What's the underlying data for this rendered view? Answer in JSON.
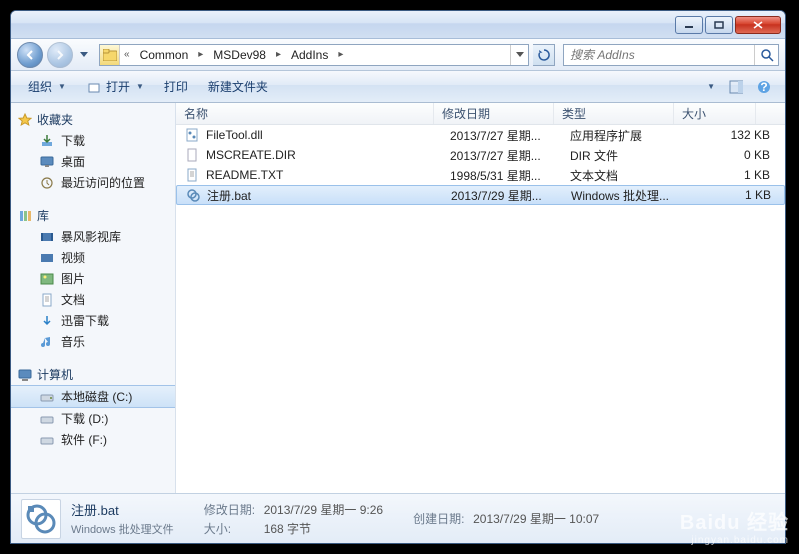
{
  "titlebar": {},
  "nav": {
    "crumbs": [
      "Common",
      "MSDev98",
      "AddIns"
    ],
    "search_placeholder": "搜索 AddIns"
  },
  "toolbar": {
    "organize": "组织",
    "open": "打开",
    "print": "打印",
    "newfolder": "新建文件夹"
  },
  "sidebar": {
    "fav": {
      "label": "收藏夹",
      "items": [
        "下载",
        "桌面",
        "最近访问的位置"
      ]
    },
    "lib": {
      "label": "库",
      "items": [
        "暴风影视库",
        "视频",
        "图片",
        "文档",
        "迅雷下载",
        "音乐"
      ]
    },
    "comp": {
      "label": "计算机",
      "items": [
        "本地磁盘 (C:)",
        "下载 (D:)",
        "软件 (F:)"
      ]
    }
  },
  "columns": {
    "name": "名称",
    "date": "修改日期",
    "type": "类型",
    "size": "大小"
  },
  "rows": [
    {
      "name": "FileTool.dll",
      "date": "2013/7/27 星期...",
      "type": "应用程序扩展",
      "size": "132 KB",
      "icon": "dll"
    },
    {
      "name": "MSCREATE.DIR",
      "date": "2013/7/27 星期...",
      "type": "DIR 文件",
      "size": "0 KB",
      "icon": "file"
    },
    {
      "name": "README.TXT",
      "date": "1998/5/31 星期...",
      "type": "文本文档",
      "size": "1 KB",
      "icon": "txt"
    },
    {
      "name": "注册.bat",
      "date": "2013/7/29 星期...",
      "type": "Windows 批处理...",
      "size": "1 KB",
      "icon": "bat",
      "selected": true
    }
  ],
  "status": {
    "title": "注册.bat",
    "subtitle": "Windows 批处理文件",
    "mod_k": "修改日期:",
    "mod_v": "2013/7/29 星期一 9:26",
    "cre_k": "创建日期:",
    "cre_v": "2013/7/29 星期一 10:07",
    "siz_k": "大小:",
    "siz_v": "168 字节"
  },
  "watermark": {
    "big": "Baidu 经验",
    "small": "jingyan.baidu.com"
  }
}
